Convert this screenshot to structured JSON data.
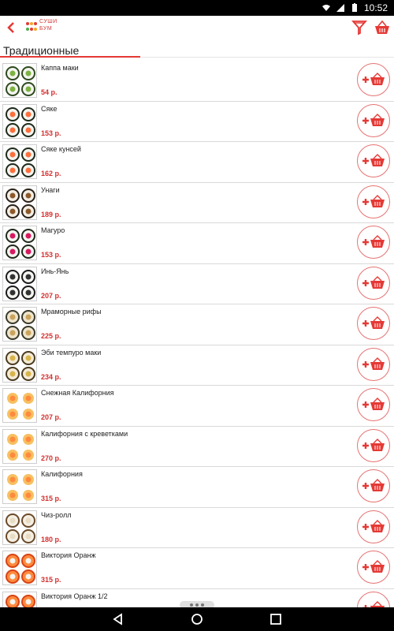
{
  "statusbar": {
    "time": "10:52"
  },
  "appbar": {
    "logo_line1": "СУШИ",
    "logo_line2": "БУМ"
  },
  "section": {
    "title": "Традиционные"
  },
  "items": [
    {
      "name": "Каппа маки",
      "price": "54 р.",
      "thumb": "cucumber"
    },
    {
      "name": "Сяке",
      "price": "153 р.",
      "thumb": "salmon"
    },
    {
      "name": "Сяке кунсей",
      "price": "162 р.",
      "thumb": "salmon"
    },
    {
      "name": "Унаги",
      "price": "189 р.",
      "thumb": "eel"
    },
    {
      "name": "Магуро",
      "price": "153 р.",
      "thumb": "tuna"
    },
    {
      "name": "Инь-Янь",
      "price": "207 р.",
      "thumb": "yinyang"
    },
    {
      "name": "Мраморные рифы",
      "price": "225 р.",
      "thumb": "marble"
    },
    {
      "name": "Эби темпуро маки",
      "price": "234 р.",
      "thumb": "tempura"
    },
    {
      "name": "Снежная Калифорния",
      "price": "207 р.",
      "thumb": "california"
    },
    {
      "name": "Калифорния с креветками",
      "price": "270 р.",
      "thumb": "california"
    },
    {
      "name": "Калифорния",
      "price": "315 р.",
      "thumb": "california"
    },
    {
      "name": "Чиз-ролл",
      "price": "180 р.",
      "thumb": "cheese"
    },
    {
      "name": "Виктория Оранж",
      "price": "315 р.",
      "thumb": "orange"
    },
    {
      "name": "Виктория Оранж 1/2",
      "price": "",
      "thumb": "orange"
    }
  ],
  "colors": {
    "accent": "#e53935",
    "price": "#d32f2f"
  },
  "icons": {
    "back": "chevron-left-icon",
    "filter": "filter-icon",
    "cart": "cart-icon",
    "add": "add-to-cart-icon"
  }
}
